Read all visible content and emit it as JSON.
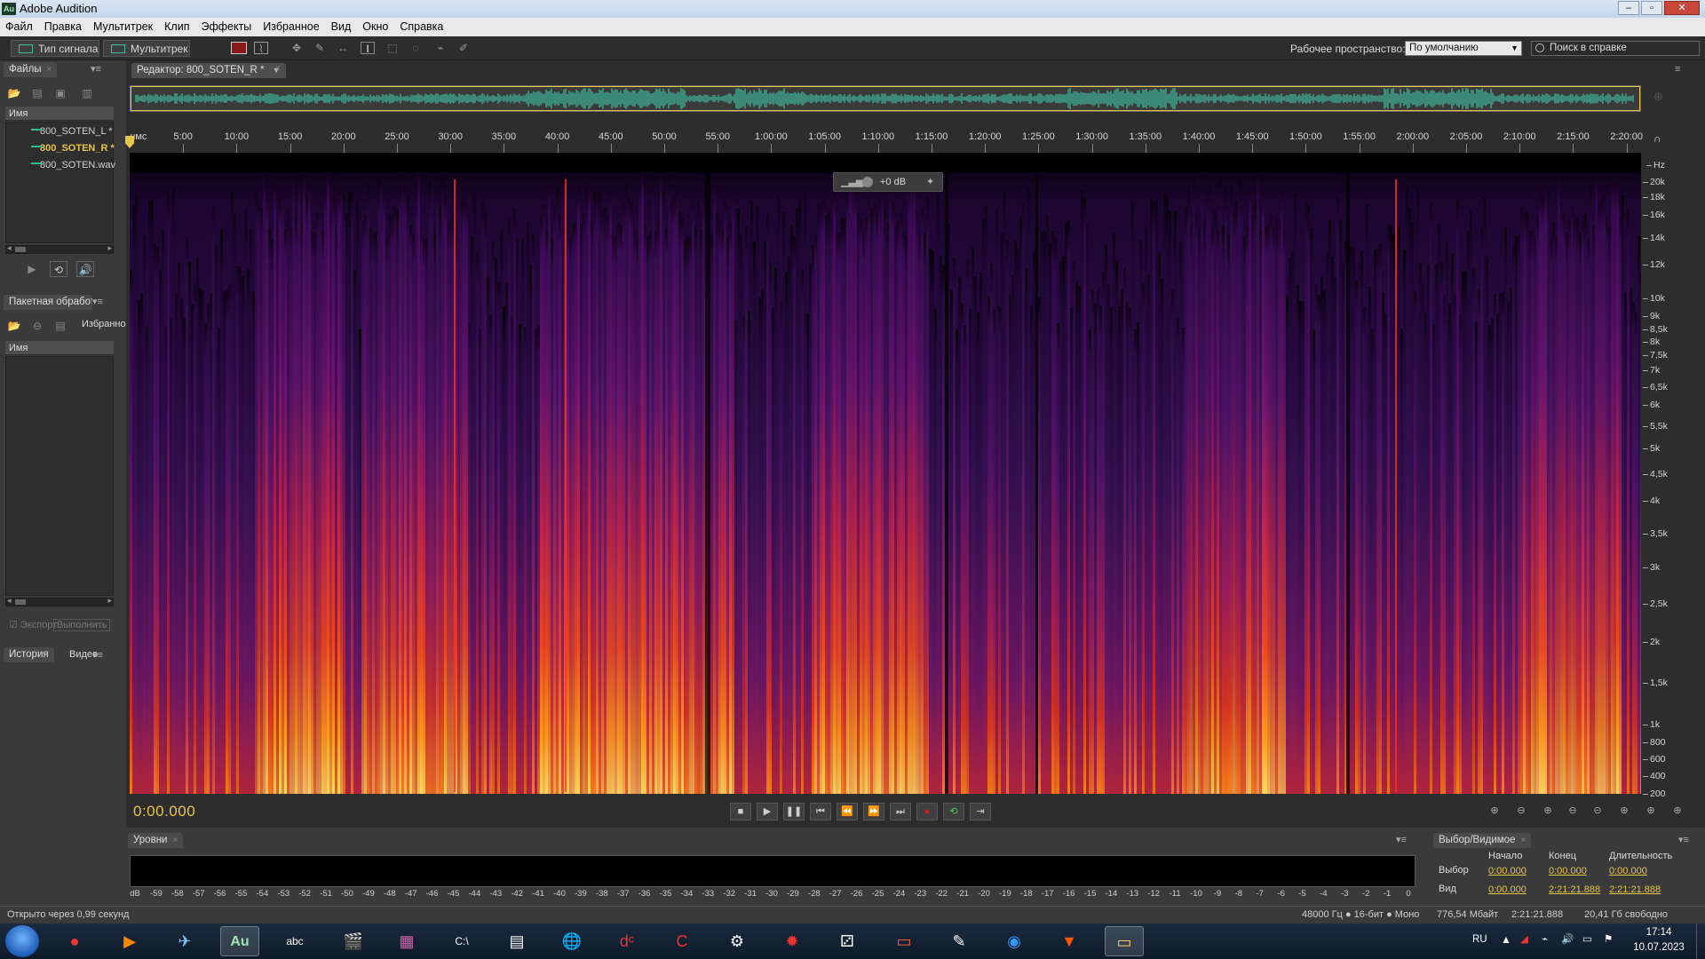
{
  "window": {
    "title": "Adobe Audition",
    "icon_label": "Au"
  },
  "menu": [
    "Файл",
    "Правка",
    "Мультитрек",
    "Клип",
    "Эффекты",
    "Избранное",
    "Вид",
    "Окно",
    "Справка"
  ],
  "toolbar": {
    "mode_waveform": "Тип сигнала",
    "mode_multitrack": "Мультитрек",
    "workspace_label": "Рабочее пространство:",
    "workspace_value": "По умолчанию",
    "search_placeholder": "Поиск в справке"
  },
  "files_panel": {
    "tab": "Файлы",
    "column": "Имя",
    "items": [
      {
        "name": "800_SOTEN_L *",
        "selected": false
      },
      {
        "name": "800_SOTEN_R *",
        "selected": true
      },
      {
        "name": "800_SOTEN.wav",
        "selected": false
      }
    ]
  },
  "batch_panel": {
    "tab": "Пакетная обработка",
    "tab2": "Избранное",
    "column": "Имя",
    "export_label": "Экспорт",
    "run_label": "Выполнить"
  },
  "history_panel": {
    "tab": "История",
    "tab2": "Видео"
  },
  "editor": {
    "tab": "Редактор: 800_SOTEN_R *",
    "hud_gain": "+0 dB",
    "current_time": "0:00.000",
    "ruler_unit": "чмс",
    "ruler_labels": [
      "5:00",
      "10:00",
      "15:00",
      "20:00",
      "25:00",
      "30:00",
      "35:00",
      "40:00",
      "45:00",
      "50:00",
      "55:00",
      "1:00:00",
      "1:05:00",
      "1:10:00",
      "1:15:00",
      "1:20:00",
      "1:25:00",
      "1:30:00",
      "1:35:00",
      "1:40:00",
      "1:45:00",
      "1:50:00",
      "1:55:00",
      "2:00:00",
      "2:05:00",
      "2:10:00",
      "2:15:00",
      "2:20:00"
    ],
    "hz_unit": "Hz",
    "hz_labels": [
      "20k",
      "18k",
      "16k",
      "14k",
      "12k",
      "10k",
      "9k",
      "8,5k",
      "8k",
      "7,5k",
      "7k",
      "6,5k",
      "6k",
      "5,5k",
      "5k",
      "4,5k",
      "4k",
      "3,5k",
      "3k",
      "2,5k",
      "2k",
      "1,5k",
      "1k",
      "800",
      "600",
      "400",
      "200"
    ]
  },
  "levels_panel": {
    "tab": "Уровни",
    "scale": [
      "dB",
      "-59",
      "-58",
      "-57",
      "-56",
      "-55",
      "-54",
      "-53",
      "-52",
      "-51",
      "-50",
      "-49",
      "-48",
      "-47",
      "-46",
      "-45",
      "-44",
      "-43",
      "-42",
      "-41",
      "-40",
      "-39",
      "-38",
      "-37",
      "-36",
      "-35",
      "-34",
      "-33",
      "-32",
      "-31",
      "-30",
      "-29",
      "-28",
      "-27",
      "-26",
      "-25",
      "-24",
      "-23",
      "-22",
      "-21",
      "-20",
      "-19",
      "-18",
      "-17",
      "-16",
      "-15",
      "-14",
      "-13",
      "-12",
      "-11",
      "-10",
      "-9",
      "-8",
      "-7",
      "-6",
      "-5",
      "-4",
      "-3",
      "-2",
      "-1",
      "0"
    ]
  },
  "selection_panel": {
    "tab": "Выбор/Видимое",
    "col_start": "Начало",
    "col_end": "Конец",
    "col_duration": "Длительность",
    "row_selection": "Выбор",
    "row_view": "Вид",
    "sel_start": "0:00.000",
    "sel_end": "0:00.000",
    "sel_duration": "0:00.000",
    "view_start": "0:00.000",
    "view_end": "2:21:21.888",
    "view_duration": "2:21:21.888"
  },
  "status": {
    "left": "Открыто через 0,99 секунд",
    "format": "48000 Гц ● 16-бит ● Моно",
    "size": "776,54 Мбайт",
    "duration": "2:21:21.888",
    "free": "20,41 Гб свободно"
  },
  "taskbar": {
    "lang": "RU",
    "time": "17:14",
    "date": "10.07.2023"
  },
  "colors": {
    "accent_yellow": "#e8c44a",
    "wave_green": "#3fbf9f",
    "panel_bg": "#3a3a3a",
    "dark_bg": "#2d2d2d"
  }
}
